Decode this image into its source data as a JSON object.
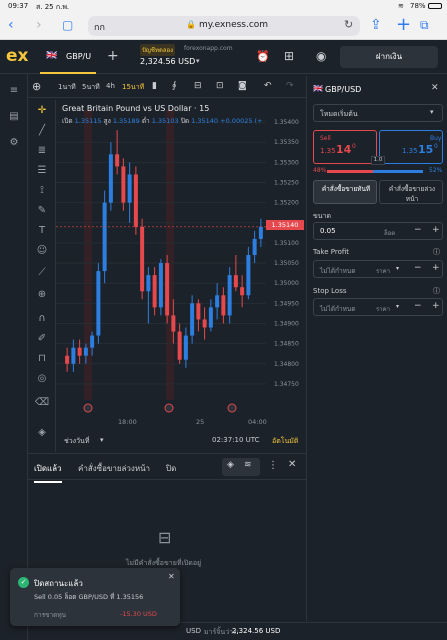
{
  "status": {
    "time": "09:37",
    "date": "ส. 25 ก.พ.",
    "battery": "78%"
  },
  "browser": {
    "reader": "กก",
    "url": "my.exness.com"
  },
  "header": {
    "logo": "ex",
    "symbol_tab": "GBP/U",
    "account_type": "ปัญชีทดลอง",
    "server": "forexonapp.com",
    "balance": "2,324.56 USD",
    "deposit": "ฝากเงิน"
  },
  "chart_toolbar": {
    "timeframes": [
      "1นาที",
      "5นาที",
      "4h",
      "15นาที"
    ],
    "active_timeframe": "15นาที"
  },
  "chart": {
    "title": "Great Britain Pound vs US Dollar · 15",
    "ohlc": {
      "open_label": "เปิด",
      "open": "1.35115",
      "high_label": "สูง",
      "high": "1.35189",
      "low_label": "ต่ำ",
      "low": "1.35103",
      "close_label": "ปิด",
      "close": "1.35140",
      "change": "+0.00025 (+"
    },
    "current_price": "1.35140",
    "x_labels": [
      "18:00",
      "25",
      "04:00"
    ],
    "footer_left": "ช่วงวันที่",
    "footer_time": "02:37:10 UTC",
    "footer_auto": "อัตโนมัติ"
  },
  "chart_data": {
    "type": "candlestick",
    "title": "Great Britain Pound vs US Dollar · 15",
    "y_ticks": [
      "1.35400",
      "1.35350",
      "1.35300",
      "1.35250",
      "1.35200",
      "1.35150",
      "1.35100",
      "1.35050",
      "1.35000",
      "1.34950",
      "1.34900",
      "1.34850",
      "1.34800",
      "1.34750"
    ],
    "ylim": [
      1.3471,
      1.3543
    ],
    "x_ticks": [
      "18:00",
      "25",
      "04:00"
    ],
    "candles": [
      [
        1.3482,
        1.3484,
        1.3478,
        1.348
      ],
      [
        1.348,
        1.3486,
        1.3478,
        1.3484
      ],
      [
        1.3484,
        1.3486,
        1.348,
        1.3482
      ],
      [
        1.3482,
        1.3485,
        1.348,
        1.3484
      ],
      [
        1.3484,
        1.3488,
        1.3482,
        1.3487
      ],
      [
        1.3487,
        1.3505,
        1.3485,
        1.3503
      ],
      [
        1.3503,
        1.3523,
        1.35,
        1.352
      ],
      [
        1.352,
        1.3535,
        1.3518,
        1.3532
      ],
      [
        1.3532,
        1.3538,
        1.3527,
        1.3529
      ],
      [
        1.3529,
        1.3531,
        1.3518,
        1.352
      ],
      [
        1.352,
        1.353,
        1.3515,
        1.3527
      ],
      [
        1.3527,
        1.3529,
        1.3512,
        1.3514
      ],
      [
        1.3514,
        1.3516,
        1.3496,
        1.3498
      ],
      [
        1.3498,
        1.3504,
        1.349,
        1.3502
      ],
      [
        1.3502,
        1.3504,
        1.3492,
        1.3494
      ],
      [
        1.3494,
        1.3506,
        1.3492,
        1.3505
      ],
      [
        1.3505,
        1.3507,
        1.349,
        1.3492
      ],
      [
        1.3492,
        1.3496,
        1.3485,
        1.3488
      ],
      [
        1.3488,
        1.349,
        1.348,
        1.3481
      ],
      [
        1.3481,
        1.3489,
        1.3479,
        1.3487
      ],
      [
        1.3487,
        1.3497,
        1.3485,
        1.3495
      ],
      [
        1.3495,
        1.3496,
        1.3488,
        1.3491
      ],
      [
        1.3491,
        1.3494,
        1.3486,
        1.3489
      ],
      [
        1.3489,
        1.3496,
        1.3488,
        1.3494
      ],
      [
        1.3494,
        1.35,
        1.3491,
        1.3497
      ],
      [
        1.3497,
        1.3499,
        1.349,
        1.3492
      ],
      [
        1.3492,
        1.3504,
        1.349,
        1.3502
      ],
      [
        1.3502,
        1.3507,
        1.3498,
        1.3499
      ],
      [
        1.3499,
        1.3502,
        1.3494,
        1.3497
      ],
      [
        1.3497,
        1.3509,
        1.3496,
        1.3507
      ],
      [
        1.3507,
        1.3513,
        1.3505,
        1.3511
      ],
      [
        1.3511,
        1.3516,
        1.3509,
        1.3514
      ]
    ],
    "current": 1.3514
  },
  "bottom": {
    "tabs": [
      "เปิดแล้ว",
      "คำสั่งซื้อขายล่วงหน้า",
      "ปิด"
    ],
    "empty": "ไม่มีคำสั่งซื้อขายที่เปิดอยู่"
  },
  "toast": {
    "title": "ปิดสถานะแล้ว",
    "body": "Sell 0.05 ล็อต GBP/USD ที่ 1.35156",
    "profit_label": "การขาดทุน",
    "profit": "-15.30 USD"
  },
  "footer": {
    "a": "USD",
    "b": "มาร์จิ้นว่าง:",
    "c": "2,324.56 USD"
  },
  "right": {
    "symbol": "GBP/USD",
    "mode": "โหมดเริ่มต้น",
    "sell_label": "Sell",
    "sell_price_a": "1.35",
    "sell_price_b": "14",
    "sell_price_c": "0",
    "buy_label": "Buy",
    "buy_price_a": "1.35",
    "buy_price_b": "15",
    "buy_price_c": "0",
    "spread": "1.0",
    "pct_sell": "48%",
    "pct_buy": "52%",
    "btn_market": "คำสั่งซื้อขายทันที",
    "btn_pending": "คำสั่งซื้อขายล่วงหน้า",
    "volume_label": "ขนาด",
    "volume": "0.05",
    "volume_unit": "ล็อต",
    "tp_label": "Take Profit",
    "tp_value": "ไม่ได้กำหนด",
    "tp_unit": "ราคา",
    "sl_label": "Stop Loss",
    "sl_value": "ไม่ได้กำหนด",
    "sl_unit": "ราคา"
  },
  "colors": {
    "up": "#2c7fe0",
    "down": "#e5484d",
    "accent": "#f4c63d"
  }
}
